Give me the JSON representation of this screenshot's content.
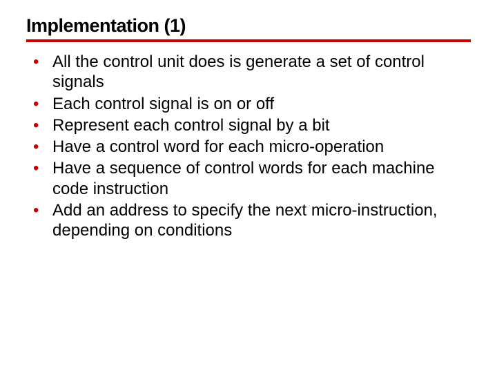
{
  "title": "Implementation (1)",
  "bullets": [
    "All the control unit does is generate a set of control signals",
    "Each control signal is on or off",
    "Represent each control signal by a bit",
    "Have a control word for each micro-operation",
    "Have a sequence of control words for each machine code instruction",
    "Add an address to specify the next micro-instruction, depending on conditions"
  ]
}
